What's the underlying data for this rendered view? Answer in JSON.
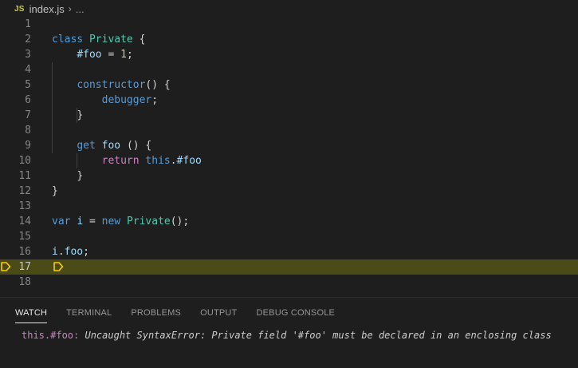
{
  "breadcrumb": {
    "file_icon": "JS",
    "file_name": "index.js",
    "separator_icon": "chevron-right-icon",
    "more": "..."
  },
  "editor": {
    "current_line": 17,
    "line_numbers": [
      "1",
      "2",
      "3",
      "4",
      "5",
      "6",
      "7",
      "8",
      "9",
      "10",
      "11",
      "12",
      "13",
      "14",
      "15",
      "16",
      "17",
      "18"
    ],
    "tokens": {
      "l2": [
        "class",
        "Private",
        "{"
      ],
      "l3": [
        "#foo",
        "=",
        "1",
        ";"
      ],
      "l5": [
        "constructor",
        "() {"
      ],
      "l6": [
        "debugger",
        ";"
      ],
      "l7": [
        "}"
      ],
      "l9": [
        "get",
        "foo",
        "() {"
      ],
      "l10": [
        "return",
        "this",
        ".#foo"
      ],
      "l11": [
        "}"
      ],
      "l12": [
        "}"
      ],
      "l14": [
        "var",
        "i",
        "=",
        "new",
        "Private",
        "();"
      ],
      "l16": [
        "i",
        ".",
        "foo",
        ";"
      ]
    }
  },
  "panel": {
    "tabs": [
      "WATCH",
      "TERMINAL",
      "PROBLEMS",
      "OUTPUT",
      "DEBUG CONSOLE"
    ],
    "active_tab": "WATCH",
    "watch": [
      {
        "expression": "this.#foo:",
        "value": "Uncaught SyntaxError: Private field '#foo' must be declared in an enclosing class"
      }
    ]
  },
  "colors": {
    "keyword": "#569cd6",
    "control": "#c586c0",
    "class": "#4ec9b0",
    "function": "#dcdcaa",
    "variable": "#9cdcfe",
    "number": "#b5cea8",
    "current_line_bg": "#4b4b18",
    "breakpoint": "#ffcc00"
  }
}
